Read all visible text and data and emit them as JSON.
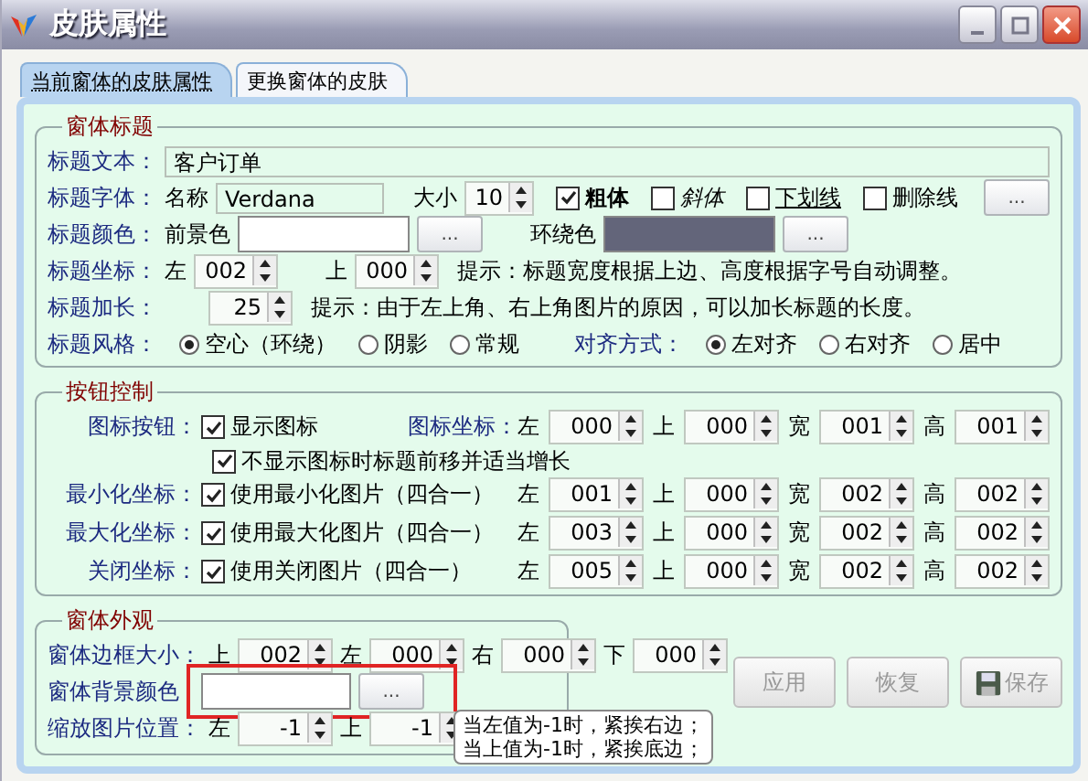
{
  "window": {
    "title": "皮肤属性"
  },
  "tabs": [
    {
      "label": "当前窗体的皮肤属性",
      "selected": true
    },
    {
      "label": "更换窗体的皮肤",
      "selected": false
    }
  ],
  "title_group": {
    "legend": "窗体标题",
    "text_row": {
      "label": "标题文本：",
      "value": "客户订单"
    },
    "font_row": {
      "label": "标题字体：",
      "name_label": "名称",
      "name_value": "Verdana",
      "size_label": "大小",
      "size_value": "10",
      "button": "...",
      "styles": [
        {
          "kind": "bold",
          "label": "粗体",
          "checked": true
        },
        {
          "kind": "italic",
          "label": "斜体",
          "checked": false
        },
        {
          "kind": "underline",
          "label": "下划线",
          "checked": false
        },
        {
          "kind": "strike",
          "label": "删除线",
          "checked": false
        }
      ]
    },
    "color_row": {
      "label": "标题颜色：",
      "colors": [
        {
          "label": "前景色",
          "color": "#ffffff",
          "button": "..."
        },
        {
          "label": "环绕色",
          "color": "#63657a",
          "button": "..."
        }
      ]
    },
    "position_row": {
      "label": "标题坐标：",
      "fields": [
        {
          "label": "左",
          "value": "002"
        },
        {
          "label": "上",
          "value": "000"
        }
      ],
      "hint": "提示：标题宽度根据上边、高度根据字号自动调整。"
    },
    "length_row": {
      "label": "标题加长：",
      "value": "25",
      "hint": "提示：由于左上角、右上角图片的原因，可以加长标题的长度。"
    },
    "style_row": {
      "label": "标题风格：",
      "options": [
        {
          "label": "空心（环绕）",
          "selected": true
        },
        {
          "label": "阴影",
          "selected": false
        },
        {
          "label": "常规",
          "selected": false
        }
      ],
      "align_label": "对齐方式：",
      "align_options": [
        {
          "label": "左对齐",
          "selected": true
        },
        {
          "label": "右对齐",
          "selected": false
        },
        {
          "label": "居中",
          "selected": false
        }
      ]
    }
  },
  "button_group": {
    "legend": "按钮控制",
    "coords_label": "图标坐标：",
    "extra_check": {
      "label": "不显示图标时标题前移并适当增长",
      "checked": true
    },
    "rows": [
      {
        "label": "图标按钮：",
        "check": "显示图标",
        "checked": true,
        "fields": [
          {
            "label": "左",
            "value": "000"
          },
          {
            "label": "上",
            "value": "000"
          },
          {
            "label": "宽",
            "value": "001"
          },
          {
            "label": "高",
            "value": "001"
          }
        ]
      },
      {
        "label": "最小化坐标：",
        "check": "使用最小化图片（四合一）",
        "checked": true,
        "fields": [
          {
            "label": "左",
            "value": "001"
          },
          {
            "label": "上",
            "value": "000"
          },
          {
            "label": "宽",
            "value": "002"
          },
          {
            "label": "高",
            "value": "002"
          }
        ]
      },
      {
        "label": "最大化坐标：",
        "check": "使用最大化图片（四合一）",
        "checked": true,
        "fields": [
          {
            "label": "左",
            "value": "003"
          },
          {
            "label": "上",
            "value": "000"
          },
          {
            "label": "宽",
            "value": "002"
          },
          {
            "label": "高",
            "value": "002"
          }
        ]
      },
      {
        "label": "关闭坐标：",
        "check": "使用关闭图片（四合一）",
        "checked": true,
        "fields": [
          {
            "label": "左",
            "value": "005"
          },
          {
            "label": "上",
            "value": "000"
          },
          {
            "label": "宽",
            "value": "002"
          },
          {
            "label": "高",
            "value": "002"
          }
        ]
      }
    ]
  },
  "appearance_group": {
    "legend": "窗体外观",
    "border_row": {
      "label": "窗体边框大小：",
      "fields": [
        {
          "label": "上",
          "value": "002"
        },
        {
          "label": "左",
          "value": "000"
        },
        {
          "label": "右",
          "value": "000"
        },
        {
          "label": "下",
          "value": "000"
        }
      ]
    },
    "background_row": {
      "label": "窗体背景颜色",
      "color": "#ffffff",
      "button": "...",
      "highlighted": true
    },
    "scale_row": {
      "label": "缩放图片位置：",
      "fields": [
        {
          "label": "左",
          "value": "-1"
        },
        {
          "label": "上",
          "value": "-1"
        }
      ]
    },
    "tooltip": [
      "当左值为-1时，紧挨右边；",
      "当上值为-1时，紧挨底边；"
    ]
  },
  "actions": [
    {
      "kind": "apply",
      "label": "应用",
      "disabled": true
    },
    {
      "kind": "restore",
      "label": "恢复",
      "disabled": true
    },
    {
      "kind": "save",
      "label": "保存",
      "disabled": true
    }
  ]
}
